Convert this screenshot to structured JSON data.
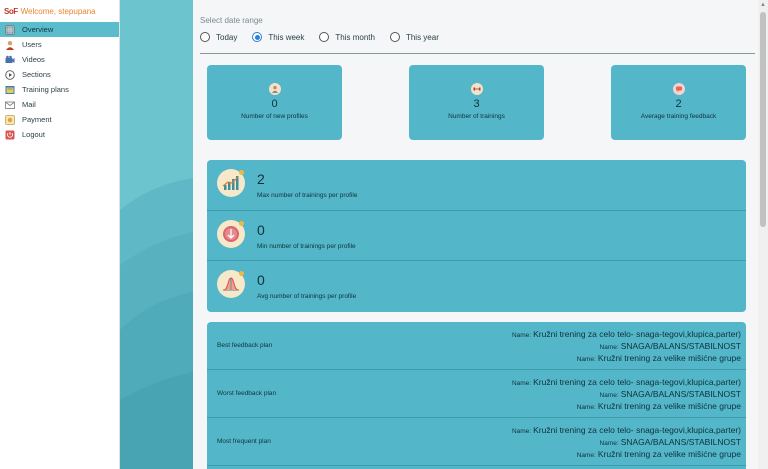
{
  "sidebar": {
    "logo": "SoF",
    "welcome": "Welcome, stepupana",
    "items": [
      {
        "label": "Overview",
        "icon": "overview-icon",
        "active": true
      },
      {
        "label": "Users",
        "icon": "user-icon"
      },
      {
        "label": "Videos",
        "icon": "video-icon"
      },
      {
        "label": "Sections",
        "icon": "sections-icon"
      },
      {
        "label": "Training plans",
        "icon": "training-plans-icon"
      },
      {
        "label": "Mail",
        "icon": "mail-icon"
      },
      {
        "label": "Payment",
        "icon": "payment-icon"
      },
      {
        "label": "Logout",
        "icon": "logout-icon"
      }
    ]
  },
  "date_range": {
    "title": "Select date range",
    "options": [
      {
        "label": "Today",
        "checked": false
      },
      {
        "label": "This week",
        "checked": true
      },
      {
        "label": "This month",
        "checked": false
      },
      {
        "label": "This year",
        "checked": false
      }
    ]
  },
  "stats": [
    {
      "value": "0",
      "label": "Number of new profiles",
      "icon": "profile-icon"
    },
    {
      "value": "3",
      "label": "Number of trainings",
      "icon": "dumbbell-icon"
    },
    {
      "value": "2",
      "label": "Average training feedback",
      "icon": "feedback-icon"
    }
  ],
  "metrics": [
    {
      "value": "2",
      "label": "Max number of trainings per profile",
      "icon": "bar-chart-icon"
    },
    {
      "value": "0",
      "label": "Min number of trainings per profile",
      "icon": "down-arrow-icon"
    },
    {
      "value": "0",
      "label": "Avg number of trainings per profile",
      "icon": "bell-curve-icon"
    }
  ],
  "plans": [
    {
      "title": "Best feedback plan",
      "names": [
        "Kružni trening za celo telo- snaga-tegovi,klupica,parter)",
        "SNAGA/BALANS/STABILNOST",
        "Kružni trening za velike mišićne grupe"
      ]
    },
    {
      "title": "Worst feedback plan",
      "names": [
        "Kružni trening za celo telo- snaga-tegovi,klupica,parter)",
        "SNAGA/BALANS/STABILNOST",
        "Kružni trening za velike mišićne grupe"
      ]
    },
    {
      "title": "Most frequent plan",
      "names": [
        "Kružni trening za celo telo- snaga-tegovi,klupica,parter)",
        "SNAGA/BALANS/STABILNOST",
        "Kružni trening za velike mišićne grupe"
      ]
    }
  ],
  "name_prefix": "Name:",
  "colors": {
    "accent": "#53b6c9",
    "active_menu": "#5bbccb",
    "welcome": "#e8862e",
    "deco": "#6cc4cf"
  }
}
